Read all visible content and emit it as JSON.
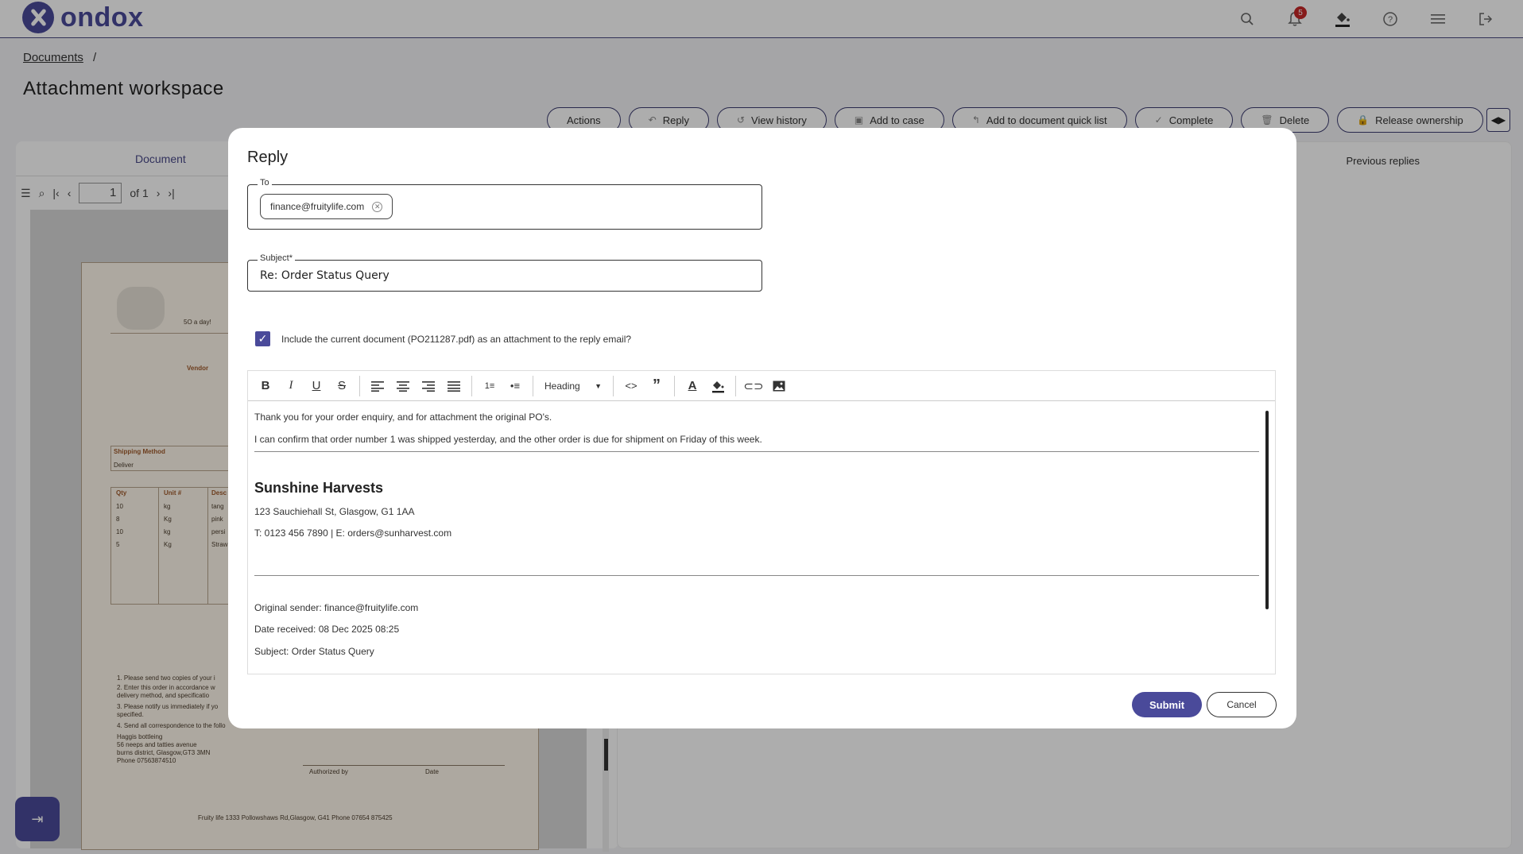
{
  "header": {
    "logo_text": "ondox",
    "notification_count": "5",
    "icons": [
      "search-icon",
      "bell-icon",
      "paint-bucket-icon",
      "help-icon",
      "menu-icon",
      "logout-icon"
    ]
  },
  "breadcrumb": {
    "root": "Documents",
    "separator": "/"
  },
  "page_title": "Attachment workspace",
  "actions": [
    {
      "label": "Actions"
    },
    {
      "label": "Reply"
    },
    {
      "label": "View history"
    },
    {
      "label": "Add to case"
    },
    {
      "label": "Add to document quick list"
    },
    {
      "label": "Complete"
    },
    {
      "label": "Delete"
    },
    {
      "label": "Release ownership"
    }
  ],
  "doc_pane": {
    "tab_label": "Document",
    "page_number": "1",
    "page_total": "of 1"
  },
  "replies_pane": {
    "tab_label": "Previous replies"
  },
  "document_preview": {
    "tagline": "5O a day!",
    "vendor": "Vendor",
    "shipping_method_label": "Shipping Method",
    "shipping_method_value": "Deliver",
    "col_qty": "Qty",
    "col_unit": "Unit #",
    "col_desc": "Desc",
    "rows": [
      {
        "qty": "10",
        "unit": "kg",
        "desc": "tang"
      },
      {
        "qty": "8",
        "unit": "Kg",
        "desc": "pink"
      },
      {
        "qty": "10",
        "unit": "kg",
        "desc": "persi"
      },
      {
        "qty": "5",
        "unit": "Kg",
        "desc": "Straw"
      }
    ],
    "notes": [
      "1.    Please send two copies of your i",
      "2.    Enter this order in accordance w",
      "       delivery method, and specificatio",
      "3.    Please notify us immediately if yo",
      "       specified.",
      "4.    Send all correspondence to the follo",
      "         Haggis bottleing",
      "         56 neeps and tatties avenue",
      "         burns district, Glasgow,GT3 3MN",
      "         Phone 07563874510"
    ],
    "authorized_by": "Authorized by",
    "date": "Date",
    "footer": "Fruity life  1333 Pollowshaws Rd,Glasgow, G41  Phone  07654 875425"
  },
  "modal": {
    "title": "Reply",
    "to_label": "To",
    "to_recipient": "finance@fruitylife.com",
    "subject_label": "Subject*",
    "subject_value": "Re: Order Status Query",
    "include_attachment_label": "Include the current document (PO211287.pdf) as an attachment to the reply email?",
    "include_attachment_checked": true,
    "toolbar": {
      "heading_select": "Heading",
      "icons": [
        "bold-icon",
        "italic-icon",
        "underline-icon",
        "strikethrough-icon",
        "align-left-icon",
        "align-center-icon",
        "align-right-icon",
        "align-justify-icon",
        "ordered-list-icon",
        "bullet-list-icon",
        "code-icon",
        "quote-icon",
        "font-color-icon",
        "highlight-icon",
        "link-icon",
        "image-icon"
      ]
    },
    "body": {
      "line1": "Thank you for your order enquiry, and for attachment the original PO's.",
      "line2": "I can confirm that order number 1 was shipped yesterday, and the other order is due for shipment on Friday of this week.",
      "company": "Sunshine Harvests",
      "address": "123 Sauchiehall St, Glasgow, G1 1AA",
      "contact": "T: 0123 456 7890 | E: orders@sunharvest.com",
      "original_sender": "Original sender: finance@fruitylife.com",
      "date_received": "Date received: 08 Dec 2025 08:25",
      "subject": "Subject: Order Status Query"
    },
    "submit_label": "Submit",
    "cancel_label": "Cancel"
  },
  "colors": {
    "brand": "#4a4a9a",
    "badge": "#c62828",
    "overlay": "rgba(0,0,0,0.32)"
  }
}
